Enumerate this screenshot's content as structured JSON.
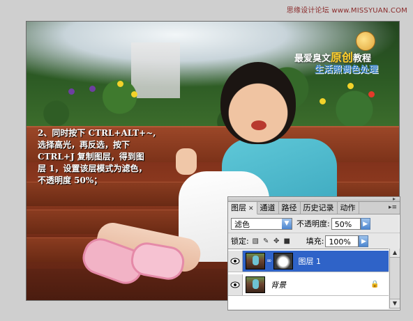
{
  "watermark": "思缘设计论坛 www.MISSYUAN.COM",
  "banner": {
    "line1_prefix": "最爱臭文",
    "line1_highlight": "原创",
    "line1_suffix": "教程",
    "line2": "生活照调色处理"
  },
  "instruction": {
    "lines": [
      "2、同时按下 CTRL+ALT+~,",
      "选择高光，再反选，按下",
      "CTRL+J 复制图层，得到图",
      "层 1，设置该层模式为滤色，",
      "不透明度 50%；"
    ]
  },
  "panel": {
    "tabs": [
      {
        "label": "图层",
        "active": true,
        "close": "✕"
      },
      {
        "label": "通道"
      },
      {
        "label": "路径"
      },
      {
        "label": "历史记录"
      },
      {
        "label": "动作"
      }
    ],
    "menu_icon": "panel-menu-icon",
    "blend_mode": "滤色",
    "opacity_label": "不透明度:",
    "opacity_value": "50%",
    "lock_label": "锁定:",
    "fill_label": "填充:",
    "fill_value": "100%",
    "layers": [
      {
        "name": "图层 1",
        "selected": true,
        "has_mask": true
      },
      {
        "name": "背景",
        "selected": false,
        "locked": true
      }
    ]
  },
  "colors": {
    "selection": "#2f63c8",
    "banner_highlight": "#ffcf2a",
    "banner_blue": "#3b82c8"
  }
}
